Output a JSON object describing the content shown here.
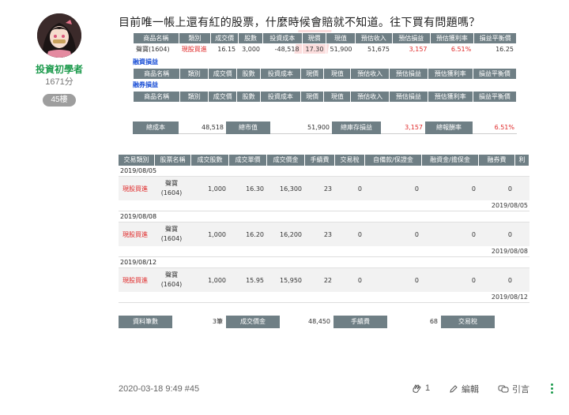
{
  "author": {
    "name": "投資初學者",
    "score": "1671分",
    "floor": "45樓"
  },
  "post": {
    "title": "目前唯一帳上還有紅的股票，什麼時候會賠就不知道。往下買有問題嗎？",
    "meta": "2020-03-18 9:49 #45",
    "like_count": "1",
    "edit_label": "編輯",
    "quote_label": "引言"
  },
  "screenshot": {
    "holdings_headers": [
      "商品名稱",
      "類別",
      "成交價",
      "股數",
      "投資成本",
      "現價",
      "現值",
      "預估收入",
      "預估損益",
      "預估獲利率",
      "損益平衡價"
    ],
    "holdings_row": [
      "聲寶(1604)",
      "現股買進",
      "16.15",
      "3,000",
      "-48,518",
      "17.30",
      "51,900",
      "51,675",
      "3,157",
      "6.51%",
      "16.25"
    ],
    "margin_label": "融資損益",
    "margin_headers": [
      "商品名稱",
      "類別",
      "成交價",
      "股數",
      "投資成本",
      "現價",
      "現值",
      "預估收入",
      "預估損益",
      "預估獲利率",
      "損益平衡價"
    ],
    "short_label": "融券損益",
    "short_headers": [
      "商品名稱",
      "類別",
      "成交價",
      "股數",
      "投資成本",
      "現價",
      "現值",
      "預估收入",
      "預估損益",
      "預估獲利率",
      "損益平衡價"
    ],
    "summary": [
      {
        "label": "總成本",
        "value": "48,518"
      },
      {
        "label": "總市值",
        "value": "51,900"
      },
      {
        "label": "總庫存損益",
        "value": "3,157"
      },
      {
        "label": "總報酬率",
        "value": "6.51%"
      }
    ],
    "trade_headers": [
      "交易類別",
      "股票名稱",
      "成交股數",
      "成交單價",
      "成交價金",
      "手續費",
      "交易稅",
      "自備款/保證金",
      "融資金/擔保金",
      "融券費",
      "利"
    ],
    "trades": [
      {
        "date": "2019/08/05",
        "kind": "現股買進",
        "name1": "聲寶",
        "name2": "(1604)",
        "qty": "1,000",
        "price": "16.30",
        "amount": "16,300",
        "fee": "23",
        "tax": "0",
        "own": "0",
        "fin": "0",
        "short_fee": "0",
        "settle": "2019/08/05"
      },
      {
        "date": "2019/08/08",
        "kind": "現股買進",
        "name1": "聲寶",
        "name2": "(1604)",
        "qty": "1,000",
        "price": "16.20",
        "amount": "16,200",
        "fee": "23",
        "tax": "0",
        "own": "0",
        "fin": "0",
        "short_fee": "0",
        "settle": "2019/08/08"
      },
      {
        "date": "2019/08/12",
        "kind": "現股買進",
        "name1": "聲寶",
        "name2": "(1604)",
        "qty": "1,000",
        "price": "15.95",
        "amount": "15,950",
        "fee": "22",
        "tax": "0",
        "own": "0",
        "fin": "0",
        "short_fee": "0",
        "settle": "2019/08/12"
      }
    ],
    "footer": [
      {
        "label": "資料筆數",
        "value": "3筆"
      },
      {
        "label": "成交價金",
        "value": "48,450"
      },
      {
        "label": "手續費",
        "value": "68"
      },
      {
        "label": "交易稅",
        "value": ""
      }
    ]
  },
  "colors": {
    "accent": "#1e9b4e",
    "header_bg": "#6f7f85",
    "profit_red": "#e02a2a",
    "link_blue": "#1a4fd6"
  }
}
